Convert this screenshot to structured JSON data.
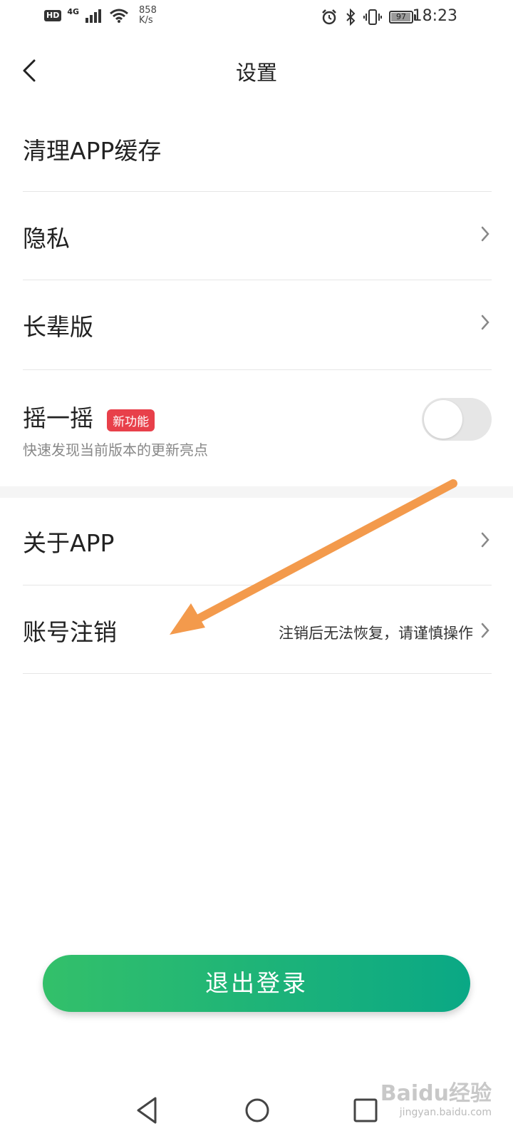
{
  "status_bar": {
    "hd": "HD",
    "network": "4G",
    "speed_value": "858",
    "speed_unit": "K/s",
    "battery": "97",
    "battery_level": 0.97,
    "time": "18:23"
  },
  "header": {
    "title": "设置",
    "back_icon": "chevron-left-icon"
  },
  "settings": {
    "clear_cache": "清理APP缓存",
    "privacy": "隐私",
    "elder_mode": "长辈版",
    "shake": {
      "label": "摇一摇",
      "badge": "新功能",
      "description": "快速发现当前版本的更新亮点",
      "enabled": false
    },
    "about": "关于APP",
    "account_cancel": {
      "label": "账号注销",
      "hint": "注销后无法恢复，请谨慎操作"
    }
  },
  "logout_button": "退出登录",
  "colors": {
    "accent_start": "#33c06a",
    "accent_end": "#0aa885",
    "badge": "#e8404a",
    "arrow": "#f39a4c"
  },
  "watermark": {
    "main": "Baidu经验",
    "sub": "jingyan.baidu.com"
  }
}
